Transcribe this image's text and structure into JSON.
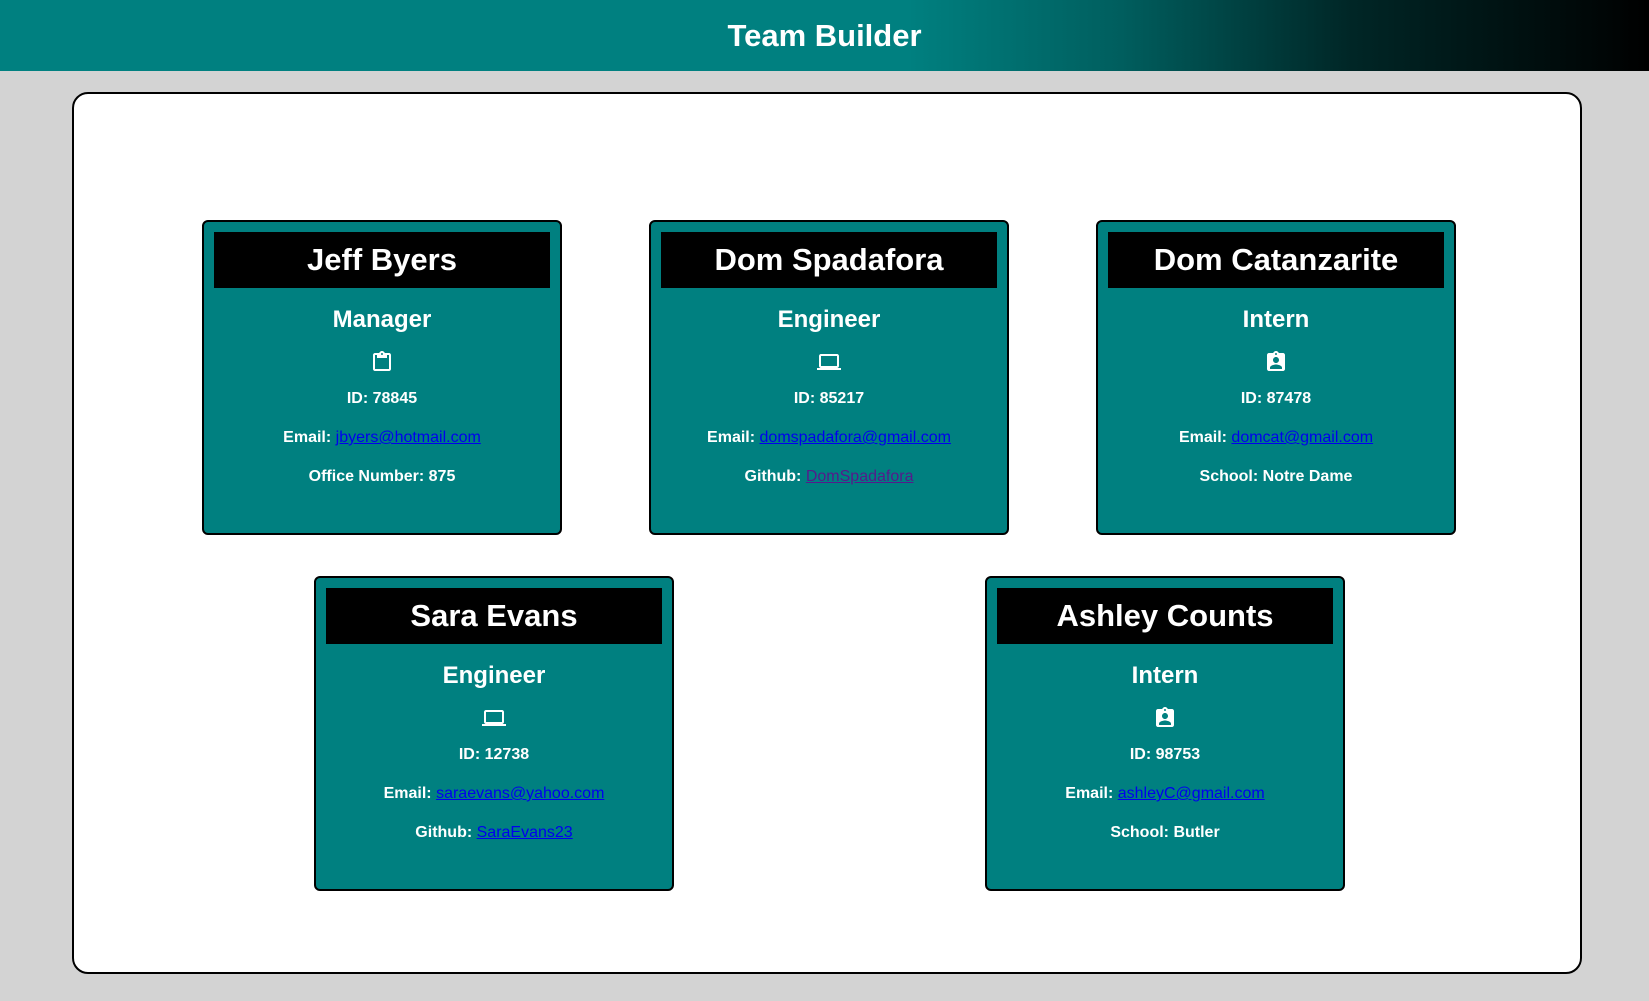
{
  "header": {
    "title": "Team Builder",
    "gradient_colors": [
      "#008080",
      "#000000"
    ]
  },
  "colors": {
    "card_bg": "#008080",
    "name_bg": "#000000",
    "link": "#0000ee",
    "visited_link": "#551a8b",
    "page_bg": "#d3d3d3"
  },
  "cards": [
    {
      "name": "Jeff Byers",
      "role": "Manager",
      "icon": "clipboard-icon",
      "id_label": "ID: 78845",
      "email_label": "Email:",
      "email": "jbyers@hotmail.com",
      "extra_label": "Office Number: 875"
    },
    {
      "name": "Dom Spadafora",
      "role": "Engineer",
      "icon": "laptop-icon",
      "id_label": "ID: 85217",
      "email_label": "Email:",
      "email": "domspadafora@gmail.com",
      "extra_label": "Github:",
      "extra_link": "DomSpadafora"
    },
    {
      "name": "Dom Catanzarite",
      "role": "Intern",
      "icon": "id-badge-icon",
      "id_label": "ID: 87478",
      "email_label": "Email:",
      "email": "domcat@gmail.com",
      "extra_label": "School: Notre Dame"
    },
    {
      "name": "Sara Evans",
      "role": "Engineer",
      "icon": "laptop-icon",
      "id_label": "ID: 12738",
      "email_label": "Email:",
      "email": "saraevans@yahoo.com",
      "extra_label": "Github:",
      "extra_link": "SaraEvans23"
    },
    {
      "name": "Ashley Counts",
      "role": "Intern",
      "icon": "id-badge-icon",
      "id_label": "ID: 98753",
      "email_label": "Email:",
      "email": "ashleyC@gmail.com",
      "extra_label": "School: Butler"
    }
  ]
}
